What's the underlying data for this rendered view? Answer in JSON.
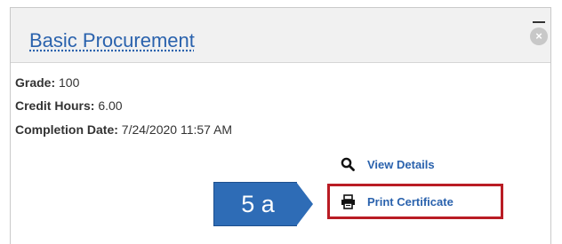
{
  "card": {
    "title": "Basic Procurement",
    "fields": [
      {
        "label": "Grade:",
        "value": "100"
      },
      {
        "label": "Credit Hours:",
        "value": "6.00"
      },
      {
        "label": "Completion Date:",
        "value": "7/24/2020 11:57 AM"
      }
    ],
    "actions": {
      "view_details": "View Details",
      "print_certificate": "Print Certificate"
    }
  },
  "callout": {
    "label": "5 a"
  },
  "icons": {
    "close": "close-icon",
    "view_details": "magnifier-icon",
    "print": "printer-icon"
  },
  "colors": {
    "link": "#2a62ad",
    "highlight_border": "#b91c24",
    "callout_fill": "#2e6cb6"
  }
}
